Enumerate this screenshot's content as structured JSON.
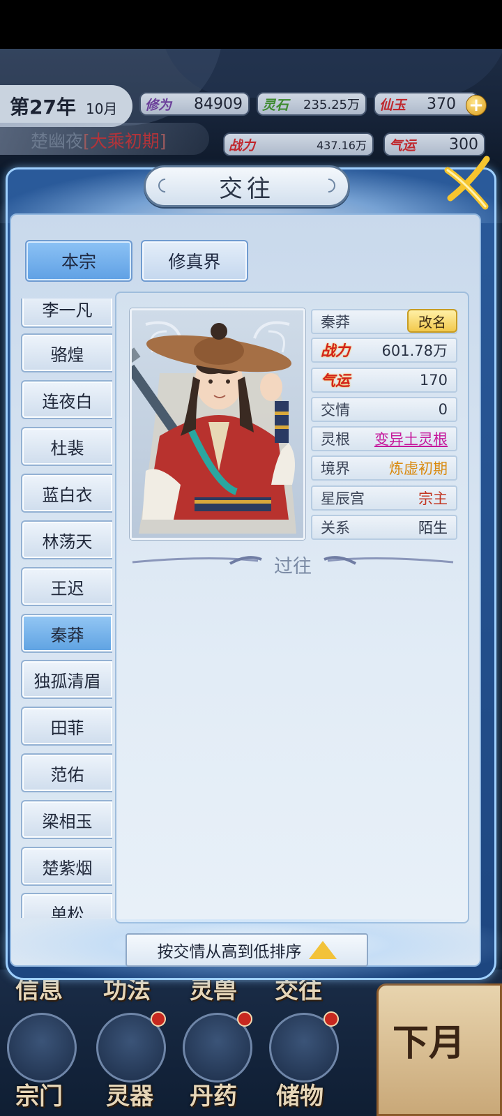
{
  "hud": {
    "year": "第27年",
    "month": "10月",
    "player_name": "楚幽夜",
    "player_realm_open": "[",
    "player_realm": "大乘初期",
    "player_realm_close": "]",
    "stats": {
      "cultivation": {
        "label": "修为",
        "value": "84909"
      },
      "spirit_stone": {
        "label": "灵石",
        "value": "235.25万"
      },
      "immortal_jade": {
        "label": "仙玉",
        "value": "370"
      },
      "combat_power": {
        "label": "战力",
        "value": "437.16万"
      },
      "luck": {
        "label": "气运",
        "value": "300"
      }
    },
    "plus": "+"
  },
  "dialog": {
    "title": "交往",
    "tabs": [
      {
        "label": "本宗",
        "active": true
      },
      {
        "label": "修真界",
        "active": false
      }
    ]
  },
  "list": {
    "items": [
      {
        "label": "李一凡"
      },
      {
        "label": "骆煌"
      },
      {
        "label": "连夜白"
      },
      {
        "label": "杜裴"
      },
      {
        "label": "蓝白衣"
      },
      {
        "label": "林荡天"
      },
      {
        "label": "王迟"
      },
      {
        "label": "秦莽",
        "selected": true
      },
      {
        "label": "独孤清眉"
      },
      {
        "label": "田菲"
      },
      {
        "label": "范佑"
      },
      {
        "label": "梁相玉"
      },
      {
        "label": "楚紫烟"
      },
      {
        "label": "单松"
      }
    ]
  },
  "detail": {
    "name": "秦莽",
    "rename_button": "改名",
    "rows": [
      {
        "key": "战力",
        "value": "601.78万"
      },
      {
        "key": "气运",
        "value": "170"
      },
      {
        "key": "交情",
        "value": "0"
      },
      {
        "key": "灵根",
        "value": "变异土灵根"
      },
      {
        "key": "境界",
        "value": "炼虚初期"
      },
      {
        "key": "星辰宫",
        "value": "宗主"
      },
      {
        "key": "关系",
        "value": "陌生"
      }
    ],
    "past_label": "过往"
  },
  "sort_button": {
    "label": "按交情从高到低排序",
    "icon": "triangle-up-icon"
  },
  "bottom_nav": {
    "row1": [
      "信息",
      "功法",
      "灵兽",
      "交往"
    ],
    "row2": [
      "宗门",
      "灵器",
      "丹药",
      "储物"
    ],
    "next_month": "下月"
  },
  "colors": {
    "accent_blue": "#5fa0e4",
    "highlight_gold": "#f2c94c",
    "realm_red": "#b2343a",
    "link_pink": "#c5179b",
    "realm_orange": "#d98a10"
  }
}
